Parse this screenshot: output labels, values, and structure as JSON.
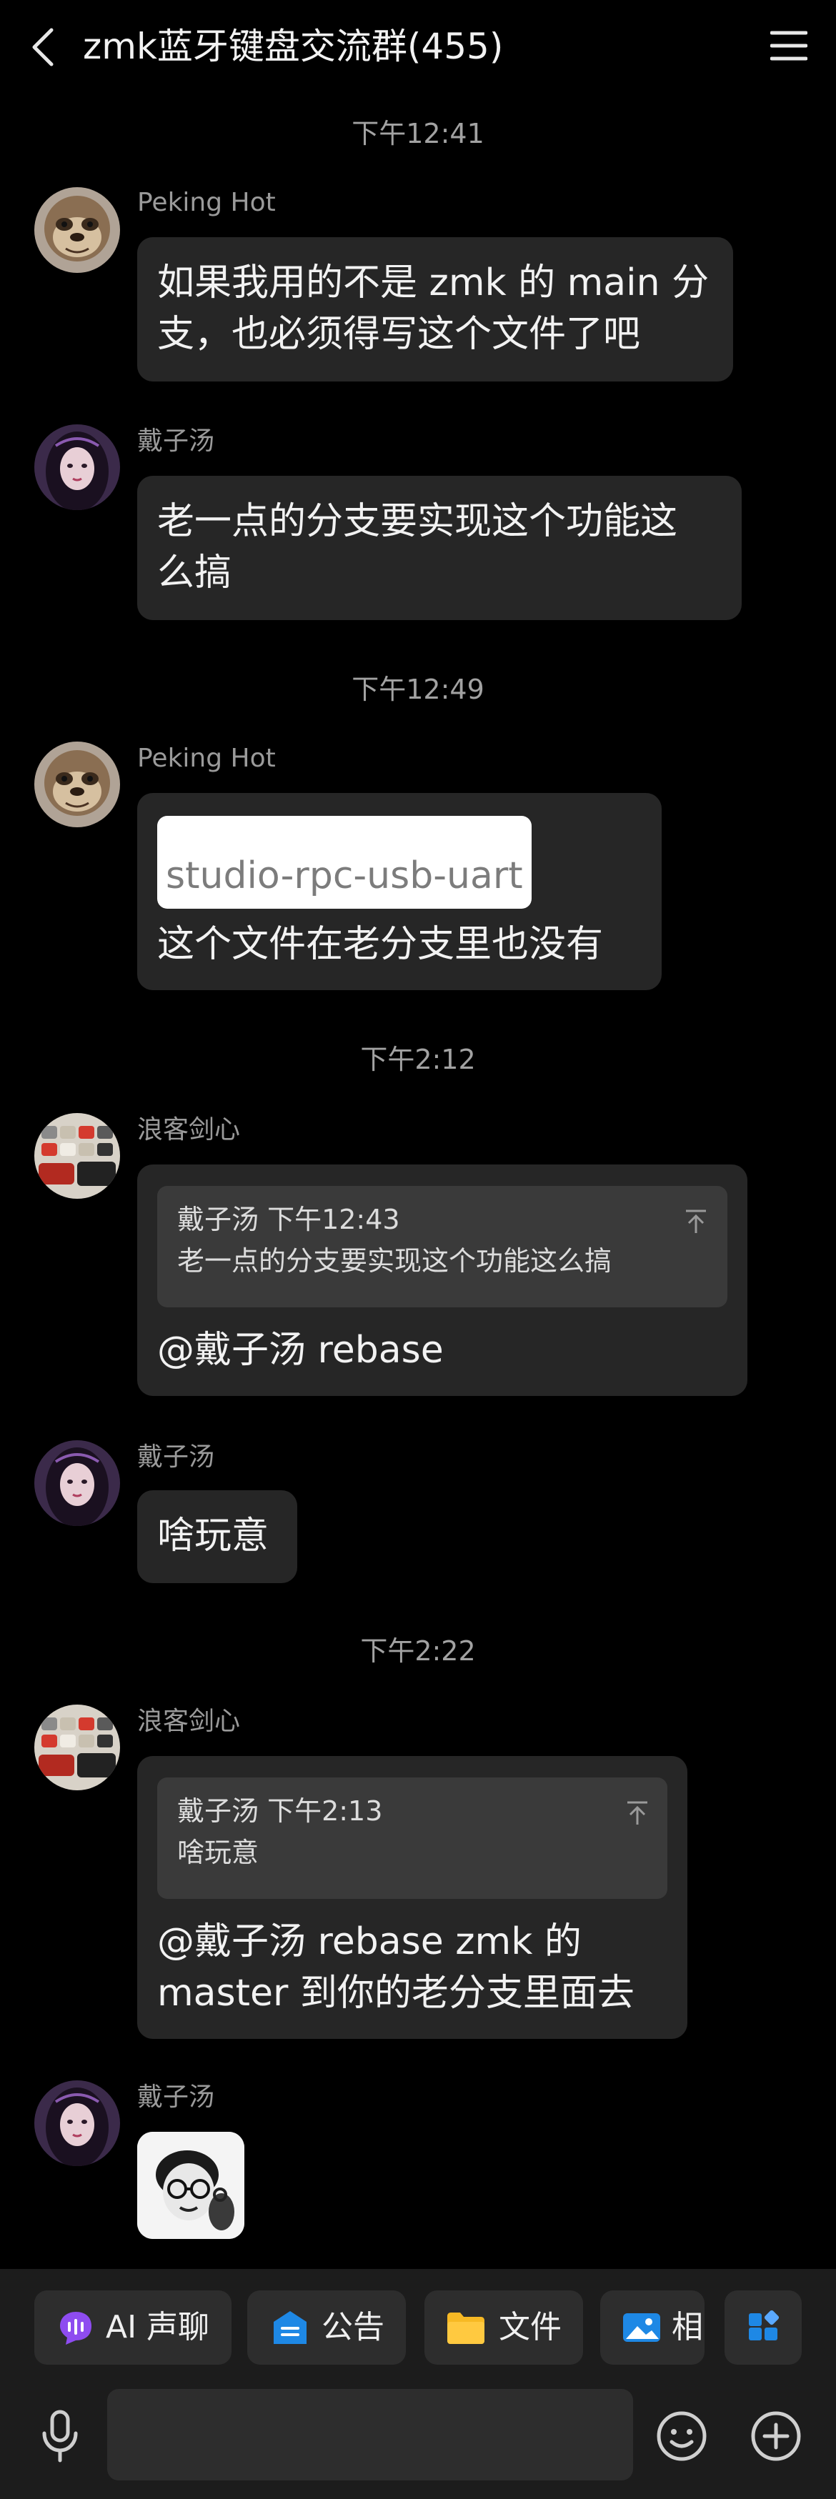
{
  "header": {
    "title": "zmk蓝牙键盘交流群(455)"
  },
  "messages": {
    "ts1": "下午12:41",
    "m1": {
      "sender": "Peking Hot",
      "line1": "如果我用的不是 zmk 的 main 分",
      "line2": "支，也必须得写这个文件了吧"
    },
    "m2": {
      "sender": "戴子汤",
      "line1": "老一点的分支要实现这个功能这",
      "line2": "么搞"
    },
    "ts2": "下午12:49",
    "m3": {
      "sender": "Peking Hot",
      "image_text": "studio-rpc-usb-uart",
      "text": "这个文件在老分支里也没有"
    },
    "ts3": "下午2:12",
    "m4": {
      "sender": "浪客剑心",
      "quote_meta": "戴子汤 下午12:43",
      "quote_text": "老一点的分支要实现这个功能这么搞",
      "text": "@戴子汤 rebase"
    },
    "m5": {
      "sender": "戴子汤",
      "text": "啥玩意"
    },
    "ts4": "下午2:22",
    "m6": {
      "sender": "浪客剑心",
      "quote_meta": "戴子汤 下午2:13",
      "quote_text": "啥玩意",
      "line1": "@戴子汤 rebase zmk 的",
      "line2": "master 到你的老分支里面去"
    },
    "m7": {
      "sender": "戴子汤"
    }
  },
  "toolbar": {
    "ai_label": "AI 声聊",
    "notice_label": "公告",
    "file_label": "文件",
    "album_label": "相"
  },
  "colors": {
    "background": "#000000",
    "bubble": "#262626",
    "quote": "#3a3a3a",
    "accent_blue": "#1e88e5",
    "ai_purple": "#8e4cf0",
    "folder_yellow": "#f7b924"
  }
}
